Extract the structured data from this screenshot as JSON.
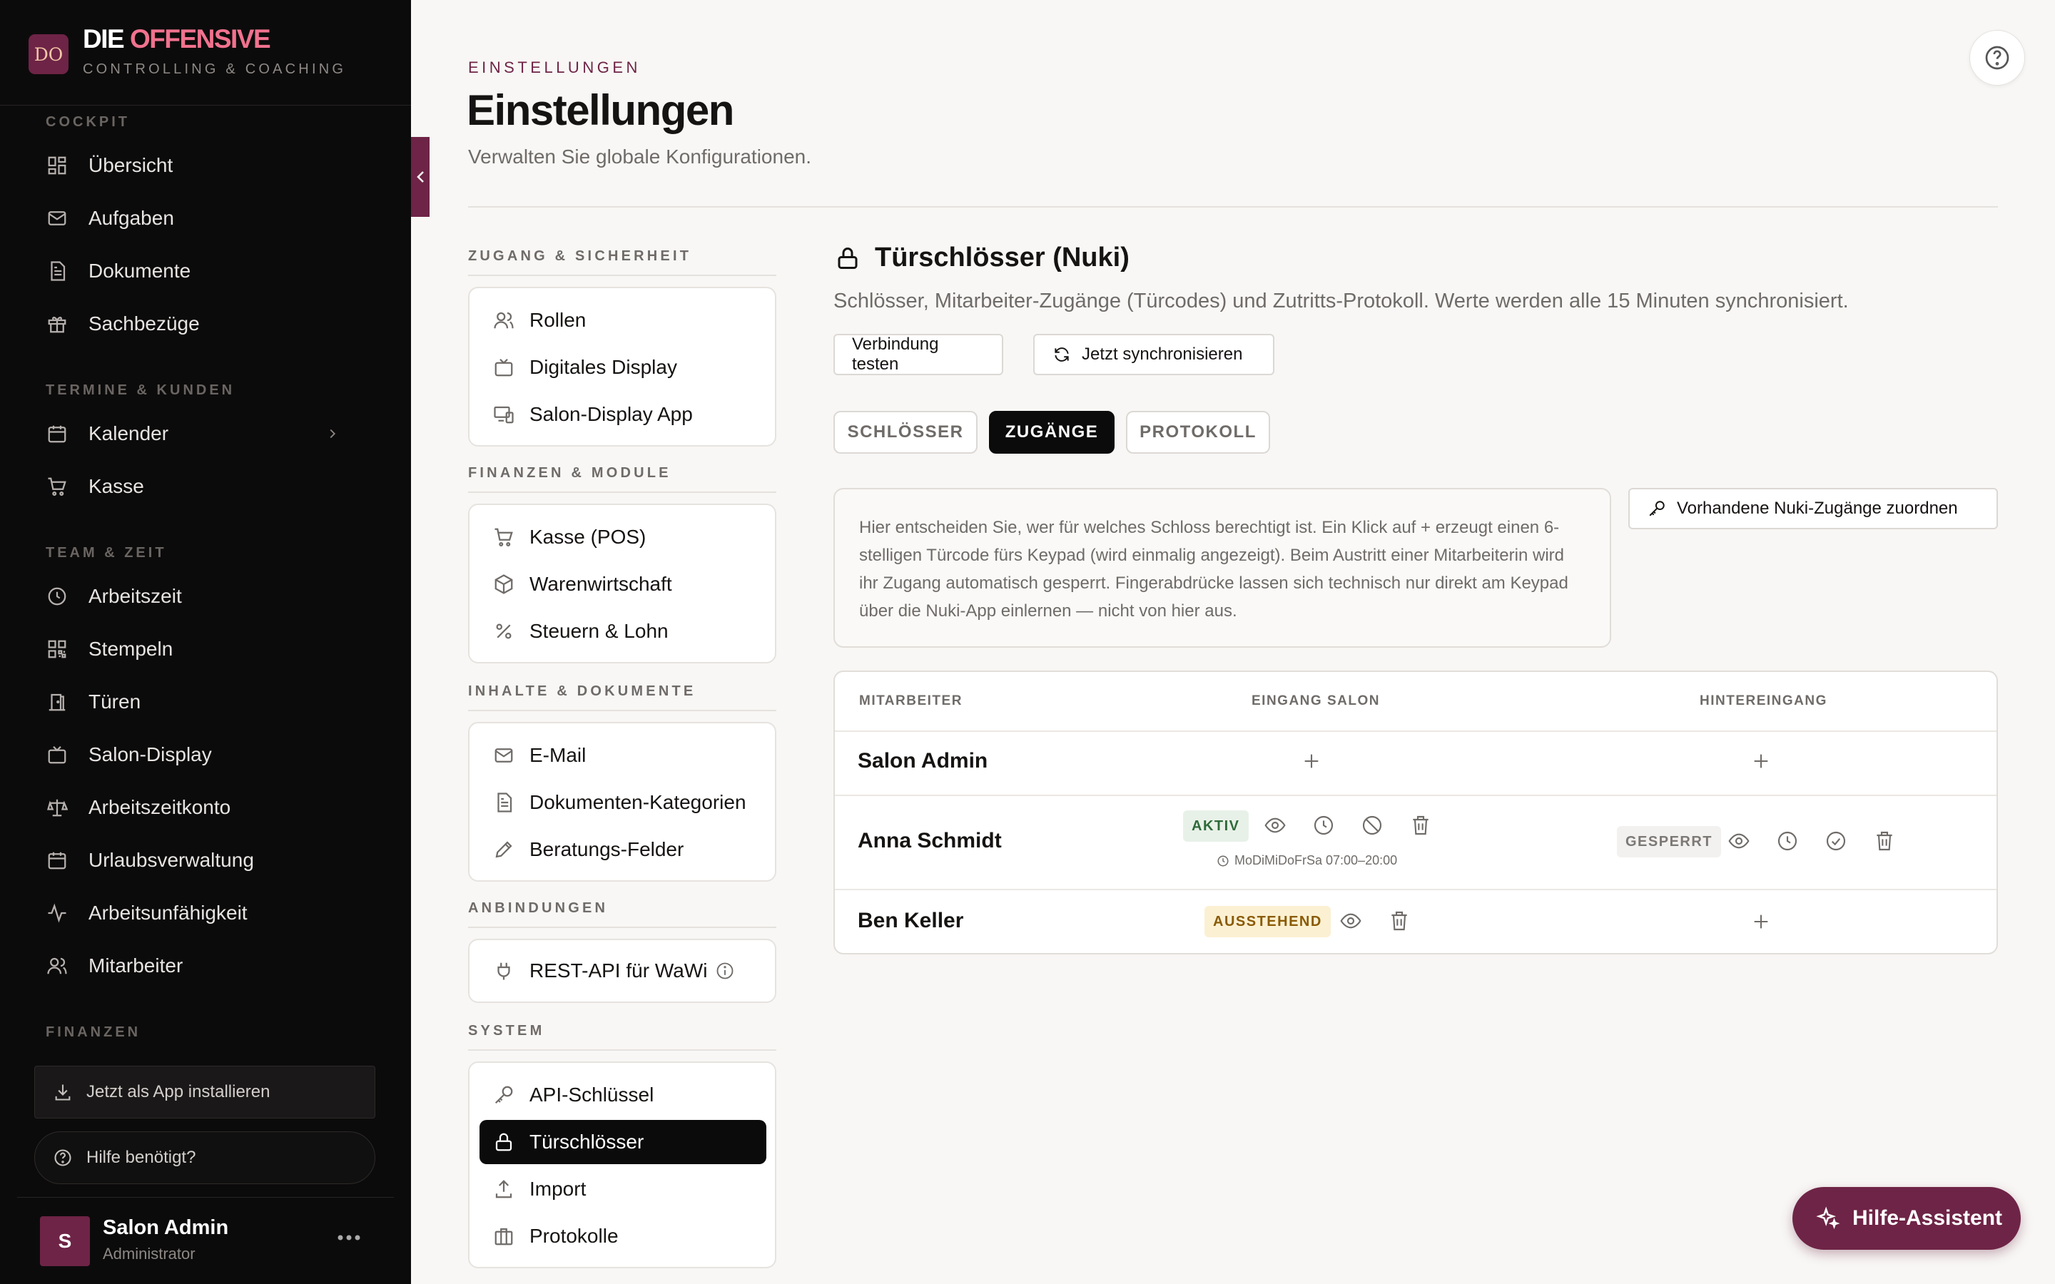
{
  "brand": {
    "logo": "DO",
    "name_1": "DIE",
    "name_2": "OFFENSIVE",
    "subtitle": "CONTROLLING & COACHING"
  },
  "sidebar": {
    "sections": [
      {
        "label": "COCKPIT",
        "items": [
          {
            "label": "Übersicht",
            "icon": "grid-icon"
          },
          {
            "label": "Aufgaben",
            "icon": "mail-icon"
          },
          {
            "label": "Dokumente",
            "icon": "document-icon"
          },
          {
            "label": "Sachbezüge",
            "icon": "gift-icon"
          }
        ]
      },
      {
        "label": "TERMINE & KUNDEN",
        "items": [
          {
            "label": "Kalender",
            "icon": "calendar-icon"
          },
          {
            "label": "Kasse",
            "icon": "cart-icon"
          }
        ]
      },
      {
        "label": "TEAM & ZEIT",
        "items": [
          {
            "label": "Arbeitszeit",
            "icon": "clock-icon"
          },
          {
            "label": "Stempeln",
            "icon": "qr-icon"
          },
          {
            "label": "Türen",
            "icon": "door-icon"
          },
          {
            "label": "Salon-Display",
            "icon": "tv-icon"
          },
          {
            "label": "Arbeitszeitkonto",
            "icon": "scale-icon"
          },
          {
            "label": "Urlaubsverwaltung",
            "icon": "calendar-icon"
          },
          {
            "label": "Arbeitsunfähigkeit",
            "icon": "activity-icon"
          },
          {
            "label": "Mitarbeiter",
            "icon": "users-icon"
          }
        ]
      },
      {
        "label": "FINANZEN",
        "items": []
      }
    ],
    "install_label": "Jetzt als App installieren",
    "help_label": "Hilfe benötigt?",
    "user": {
      "initial": "S",
      "name": "Salon Admin",
      "role": "Administrator"
    }
  },
  "header": {
    "breadcrumb": "EINSTELLUNGEN",
    "title": "Einstellungen",
    "subtitle": "Verwalten Sie globale Konfigurationen."
  },
  "settings_nav": {
    "groups": [
      {
        "label": "ZUGANG & SICHERHEIT",
        "items": [
          {
            "label": "Rollen",
            "icon": "users-icon"
          },
          {
            "label": "Digitales Display",
            "icon": "tv-icon"
          },
          {
            "label": "Salon-Display App",
            "icon": "devices-icon"
          }
        ]
      },
      {
        "label": "FINANZEN & MODULE",
        "items": [
          {
            "label": "Kasse (POS)",
            "icon": "cart-icon"
          },
          {
            "label": "Warenwirtschaft",
            "icon": "box-icon"
          },
          {
            "label": "Steuern & Lohn",
            "icon": "percent-icon"
          }
        ]
      },
      {
        "label": "INHALTE & DOKUMENTE",
        "items": [
          {
            "label": "E-Mail",
            "icon": "mail-icon"
          },
          {
            "label": "Dokumenten-Kategorien",
            "icon": "document-icon"
          },
          {
            "label": "Beratungs-Felder",
            "icon": "pencil-icon"
          }
        ]
      },
      {
        "label": "ANBINDUNGEN",
        "items": [
          {
            "label": "REST-API für WaWi",
            "icon": "plug-icon"
          }
        ]
      },
      {
        "label": "SYSTEM",
        "items": [
          {
            "label": "API-Schlüssel",
            "icon": "key-icon"
          },
          {
            "label": "Türschlösser",
            "icon": "lock-icon",
            "active": true
          },
          {
            "label": "Import",
            "icon": "upload-icon"
          },
          {
            "label": "Protokolle",
            "icon": "briefcase-icon"
          }
        ]
      }
    ]
  },
  "panel": {
    "title": "Türschlösser (Nuki)",
    "description": "Schlösser, Mitarbeiter-Zugänge (Türcodes) und Zutritts-Protokoll. Werte werden alle 15 Minuten synchronisiert.",
    "test_label": "Verbindung testen",
    "sync_label": "Jetzt synchronisieren",
    "tabs": [
      "SCHLÖSSER",
      "ZUGÄNGE",
      "PROTOKOLL"
    ],
    "active_tab": "ZUGÄNGE",
    "info": "Hier entscheiden Sie, wer für welches Schloss berechtigt ist. Ein Klick auf + erzeugt einen 6-stelligen Türcode fürs Keypad (wird einmalig angezeigt). Beim Austritt einer Mitarbeiterin wird ihr Zugang automatisch gesperrt. Fingerabdrücke lassen sich technisch nur direkt am Keypad über die Nuki-App einlernen — nicht von hier aus.",
    "assign_label": "Vorhandene Nuki-Zugänge zuordnen",
    "table": {
      "columns": [
        "MITARBEITER",
        "EINGANG SALON",
        "HINTEREINGANG"
      ],
      "rows": [
        {
          "name": "Salon Admin",
          "eingang": {
            "status": "",
            "schedule": ""
          },
          "hinter": {
            "status": ""
          }
        },
        {
          "name": "Anna Schmidt",
          "eingang": {
            "status": "AKTIV",
            "schedule": "MoDiMiDoFrSa 07:00–20:00"
          },
          "hinter": {
            "status": "GESPERRT"
          }
        },
        {
          "name": "Ben Keller",
          "eingang": {
            "status": "AUSSTEHEND",
            "schedule": ""
          },
          "hinter": {
            "status": ""
          }
        }
      ]
    }
  },
  "assistant_label": "Hilfe-Assistent",
  "colors": {
    "accent": "#6e2446",
    "sidebar_bg": "#0c0b0b",
    "brand_pink": "#f0728e",
    "active_green": "#2e6a3a",
    "pending_amber": "#8a5a05"
  }
}
